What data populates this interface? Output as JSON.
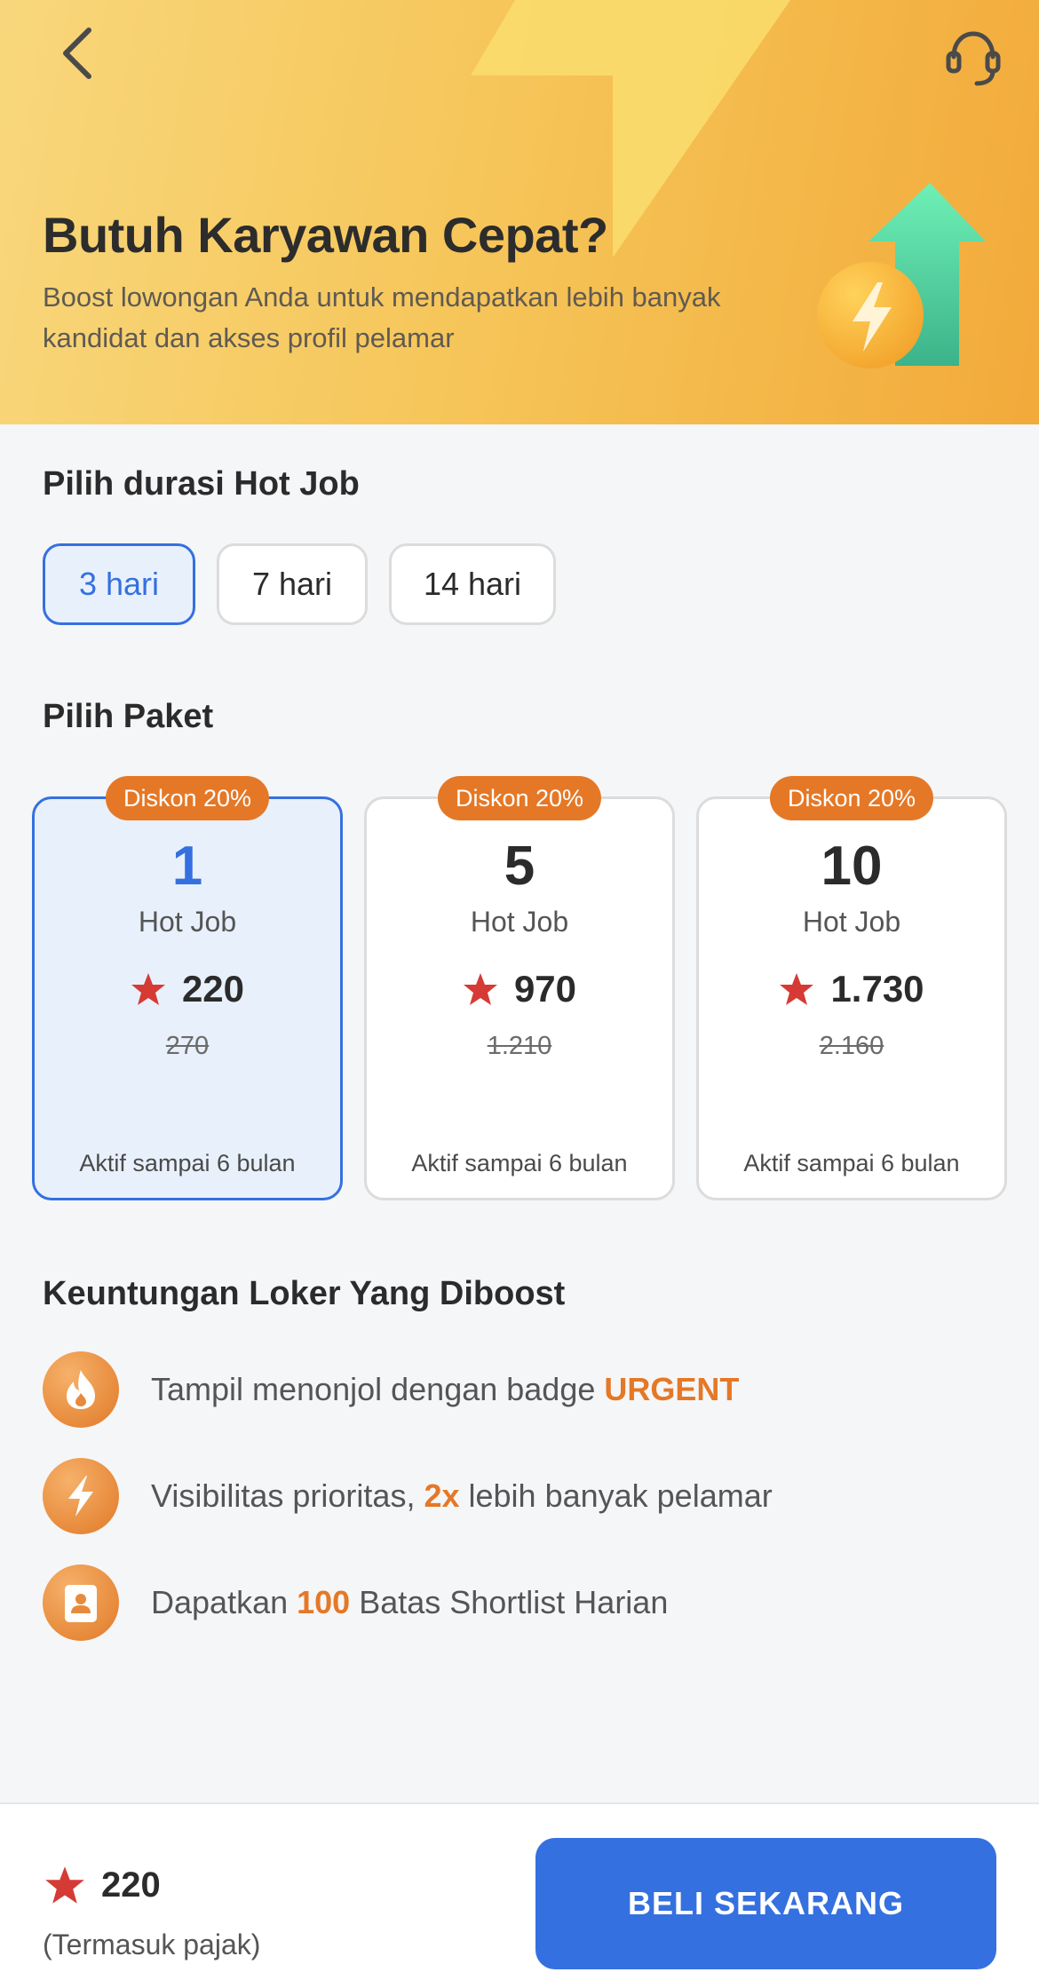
{
  "header": {
    "back_icon": "chevron-left-icon",
    "support_icon": "headset-icon",
    "title": "Butuh Karyawan Cepat?",
    "subtitle": "Boost lowongan Anda untuk mendapatkan lebih banyak kandidat dan akses profil pelamar"
  },
  "duration": {
    "title": "Pilih durasi Hot Job",
    "options": [
      {
        "label": "3 hari",
        "selected": true
      },
      {
        "label": "7 hari",
        "selected": false
      },
      {
        "label": "14 hari",
        "selected": false
      }
    ]
  },
  "packages": {
    "title": "Pilih Paket",
    "items": [
      {
        "badge": "Diskon 20%",
        "count": "1",
        "unit": "Hot Job",
        "price": "220",
        "old_price": "270",
        "validity": "Aktif sampai 6 bulan",
        "selected": true
      },
      {
        "badge": "Diskon 20%",
        "count": "5",
        "unit": "Hot Job",
        "price": "970",
        "old_price": "1.210",
        "validity": "Aktif sampai 6 bulan",
        "selected": false
      },
      {
        "badge": "Diskon 20%",
        "count": "10",
        "unit": "Hot Job",
        "price": "1.730",
        "old_price": "2.160",
        "validity": "Aktif sampai 6 bulan",
        "selected": false
      }
    ]
  },
  "benefits": {
    "title": "Keuntungan Loker Yang Diboost",
    "items": [
      {
        "icon": "flame-icon",
        "prefix": "Tampil menonjol dengan badge ",
        "highlight": "URGENT",
        "suffix": ""
      },
      {
        "icon": "lightning-icon",
        "prefix": "Visibilitas prioritas, ",
        "highlight": "2x",
        "suffix": " lebih banyak pelamar"
      },
      {
        "icon": "profile-card-icon",
        "prefix": "Dapatkan ",
        "highlight": "100",
        "suffix": " Batas Shortlist Harian"
      }
    ]
  },
  "footer": {
    "price": "220",
    "tax_note": "(Termasuk pajak)",
    "buy_label": "BELI SEKARANG"
  },
  "colors": {
    "primary": "#3570e0",
    "accent": "#e57826",
    "star": "#d63a35",
    "selected_bg": "#e8f1fb"
  }
}
